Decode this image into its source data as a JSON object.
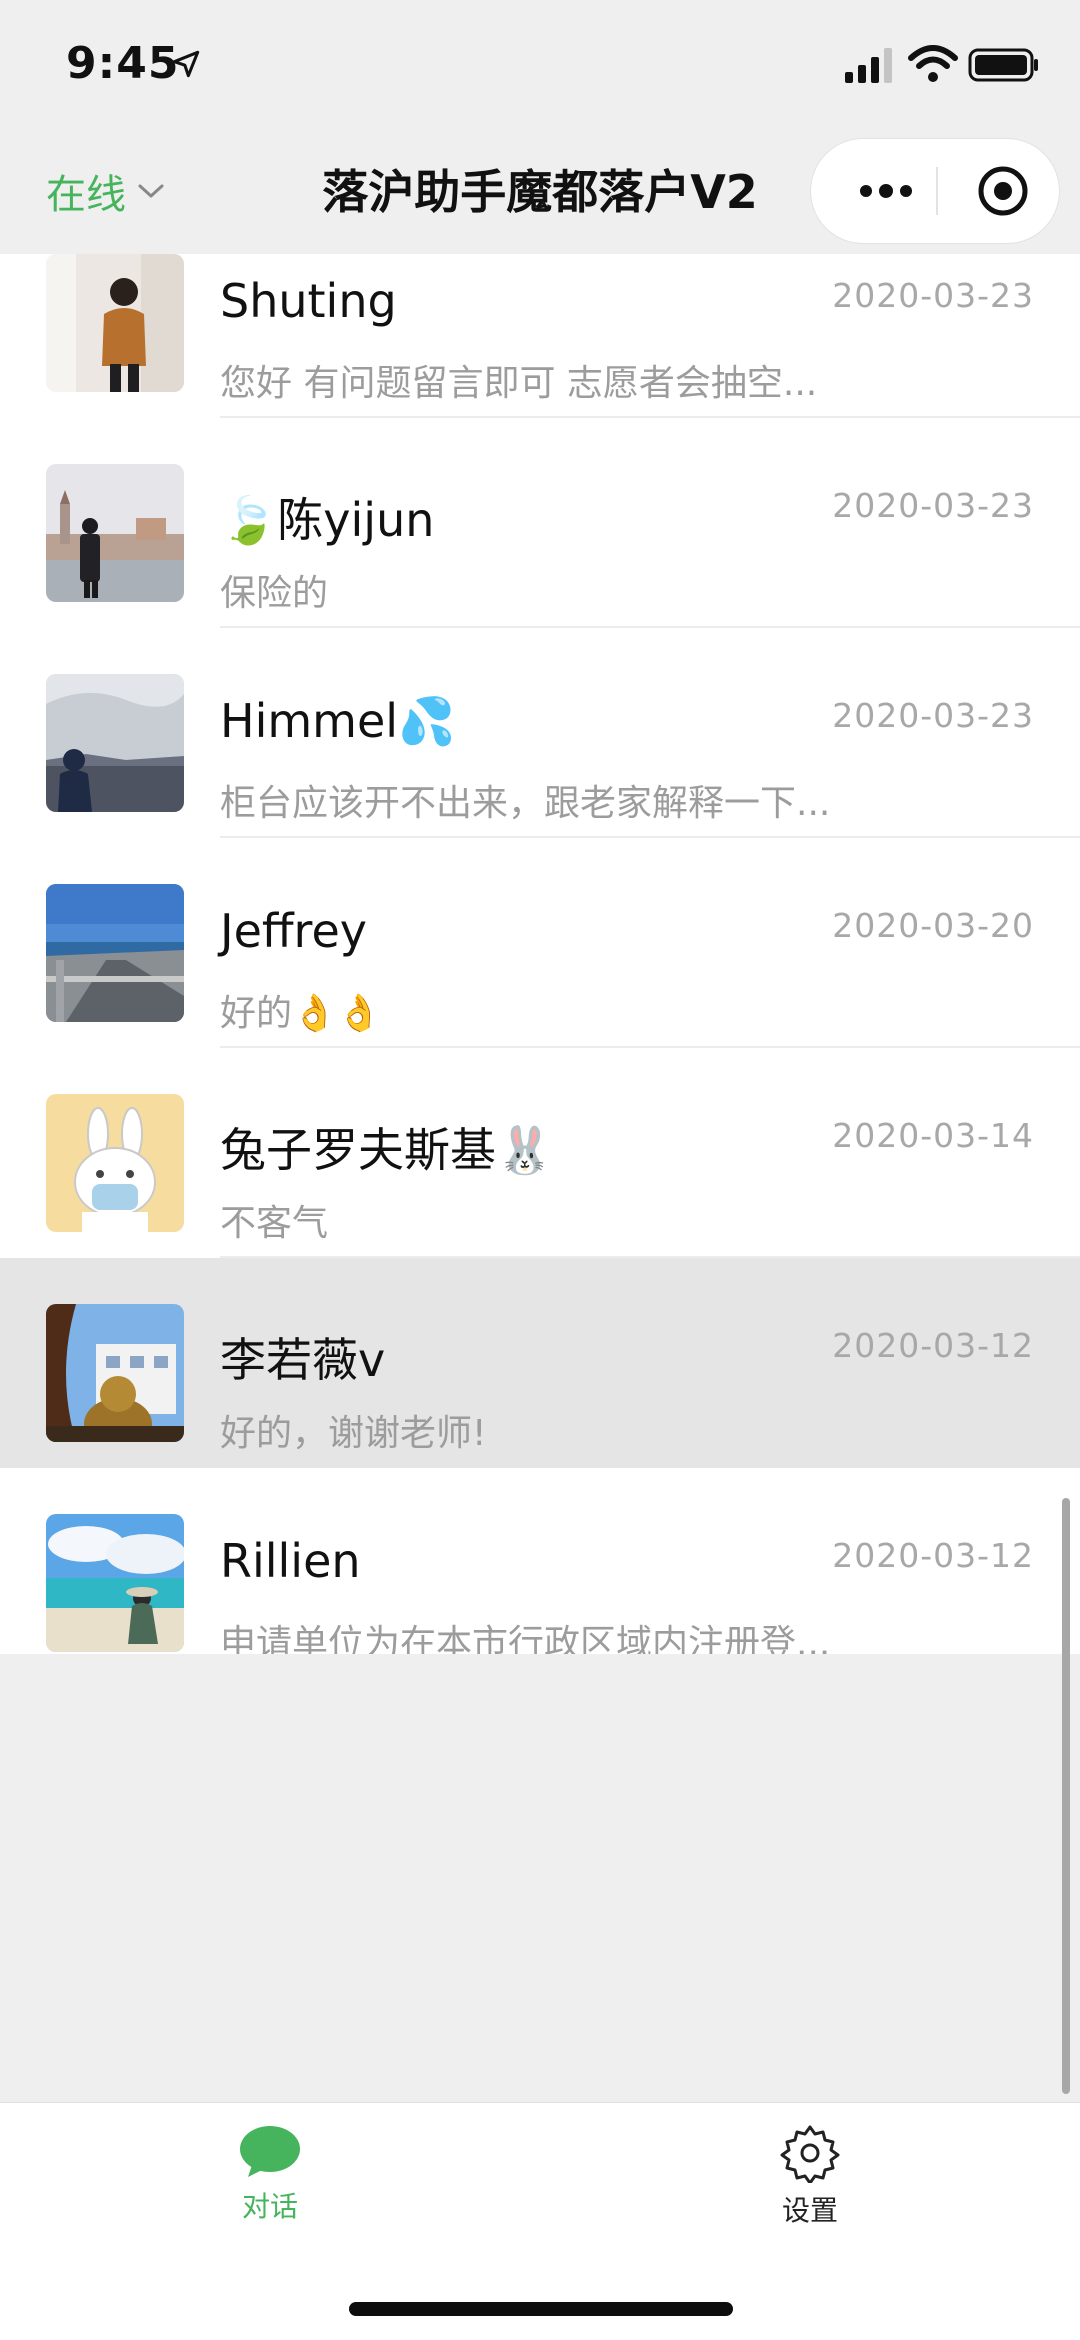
{
  "status_bar": {
    "time": "9:45"
  },
  "nav": {
    "online_label": "在线",
    "title": "落沪助手魔都落户V2",
    "more_icon": "more-dots-icon",
    "close_icon": "target-circle-icon"
  },
  "conversations": [
    {
      "name": "Shuting",
      "date": "2020-03-23",
      "preview": "您好 有问题留言即可 志愿者会抽空..."
    },
    {
      "name": "陈yijun",
      "emoji": "🍃",
      "date": "2020-03-23",
      "preview": "保险的"
    },
    {
      "name": "Himmel",
      "emoji": "💦",
      "date": "2020-03-23",
      "preview": "柜台应该开不出来，跟老家解释一下..."
    },
    {
      "name": "Jeffrey",
      "date": "2020-03-20",
      "preview": "好的",
      "preview_emoji": "👌👌"
    },
    {
      "name": "兔子罗夫斯基",
      "emoji": "🐰",
      "date": "2020-03-14",
      "preview": "不客气"
    },
    {
      "name": "李若薇v",
      "date": "2020-03-12",
      "preview": "好的，谢谢老师!",
      "active": true
    },
    {
      "name": "Rillien",
      "date": "2020-03-12",
      "preview": "申请单位为在本市行政区域内注册登..."
    }
  ],
  "tabbar": {
    "chat_label": "对话",
    "settings_label": "设置",
    "accent": "#46b45c"
  }
}
